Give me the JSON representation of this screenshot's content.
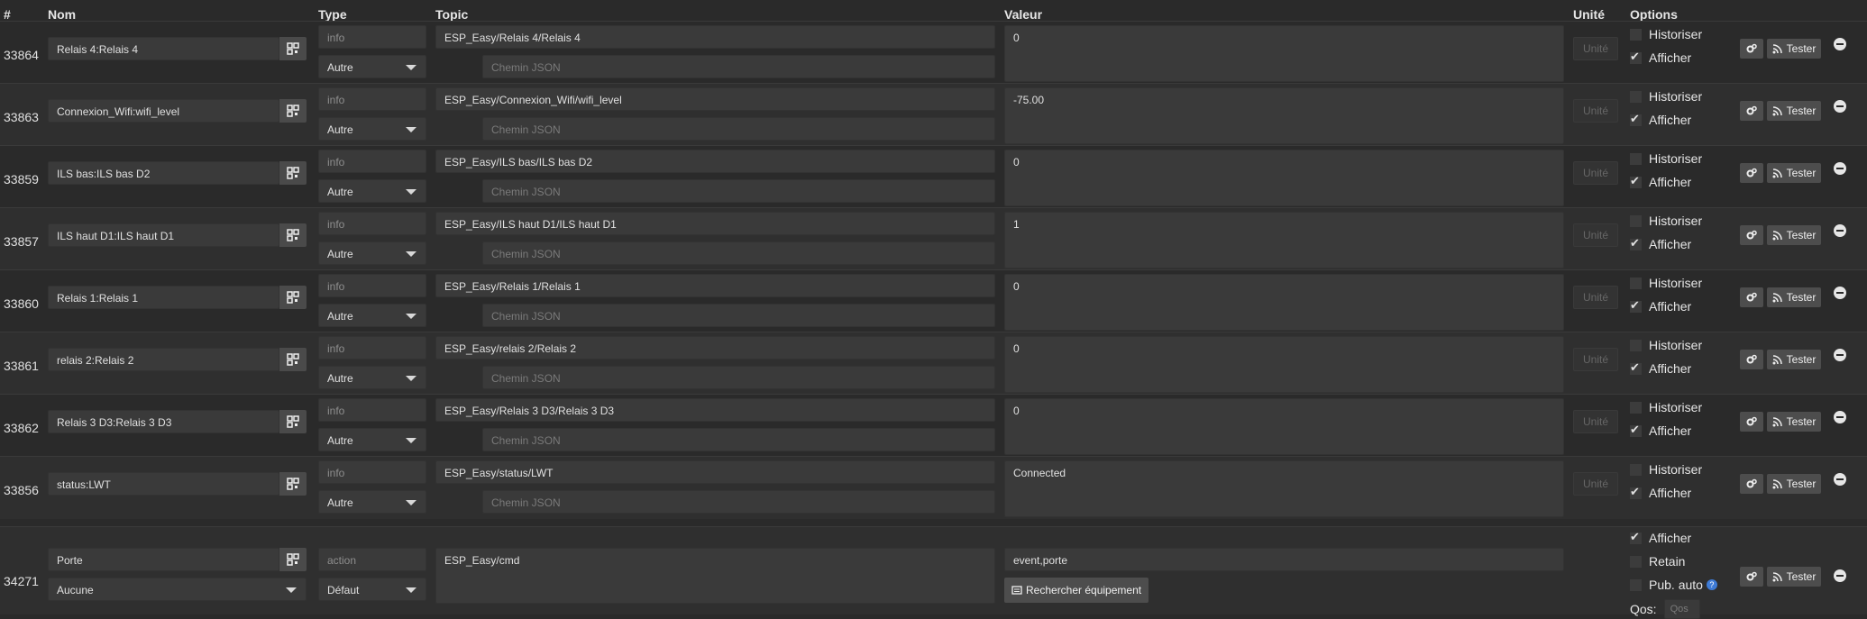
{
  "headers": {
    "num": "#",
    "nom": "Nom",
    "type": "Type",
    "topic": "Topic",
    "valeur": "Valeur",
    "unite": "Unité",
    "options": "Options"
  },
  "labels": {
    "historiser": "Historiser",
    "afficher": "Afficher",
    "tester": "Tester",
    "chemin_placeholder": "Chemin JSON",
    "unite_placeholder": "Unité",
    "retain": "Retain",
    "pub_auto": "Pub. auto",
    "qos": "Qos:",
    "qos_placeholder": "Qos",
    "rechercher": "Rechercher équipement",
    "help": "?"
  },
  "rows": [
    {
      "id": "33864",
      "nom": "Relais 4:Relais 4",
      "type": "info",
      "subtype": "Autre",
      "topic": "ESP_Easy/Relais 4/Relais 4",
      "valeur": "0",
      "historiser": false,
      "afficher": true
    },
    {
      "id": "33863",
      "nom": "Connexion_Wifi:wifi_level",
      "type": "info",
      "subtype": "Autre",
      "topic": "ESP_Easy/Connexion_Wifi/wifi_level",
      "valeur": "-75.00",
      "historiser": false,
      "afficher": true
    },
    {
      "id": "33859",
      "nom": "ILS bas:ILS bas D2",
      "type": "info",
      "subtype": "Autre",
      "topic": "ESP_Easy/ILS bas/ILS bas D2",
      "valeur": "0",
      "historiser": false,
      "afficher": true
    },
    {
      "id": "33857",
      "nom": "ILS haut D1:ILS haut D1",
      "type": "info",
      "subtype": "Autre",
      "topic": "ESP_Easy/ILS haut D1/ILS haut D1",
      "valeur": "1",
      "historiser": false,
      "afficher": true
    },
    {
      "id": "33860",
      "nom": "Relais 1:Relais 1",
      "type": "info",
      "subtype": "Autre",
      "topic": "ESP_Easy/Relais 1/Relais 1",
      "valeur": "0",
      "historiser": false,
      "afficher": true
    },
    {
      "id": "33861",
      "nom": "relais 2:Relais 2",
      "type": "info",
      "subtype": "Autre",
      "topic": "ESP_Easy/relais 2/Relais 2",
      "valeur": "0",
      "historiser": false,
      "afficher": true
    },
    {
      "id": "33862",
      "nom": "Relais 3 D3:Relais 3 D3",
      "type": "info",
      "subtype": "Autre",
      "topic": "ESP_Easy/Relais 3 D3/Relais 3 D3",
      "valeur": "0",
      "historiser": false,
      "afficher": true
    },
    {
      "id": "33856",
      "nom": "status:LWT",
      "type": "info",
      "subtype": "Autre",
      "topic": "ESP_Easy/status/LWT",
      "valeur": "Connected",
      "historiser": false,
      "afficher": true
    }
  ],
  "action_row": {
    "id": "34271",
    "nom": "Porte",
    "linked": "Aucune",
    "type": "action",
    "subtype": "Défaut",
    "topic": "ESP_Easy/cmd",
    "valeur": "event,porte",
    "afficher": true,
    "retain": false,
    "pub_auto": false
  }
}
